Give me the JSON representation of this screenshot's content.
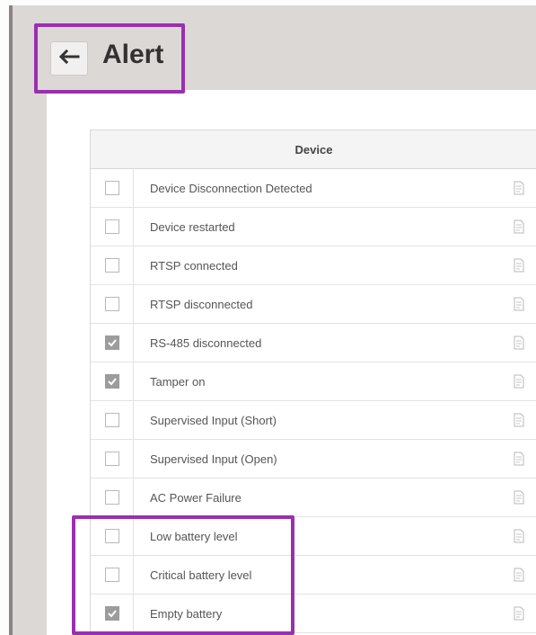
{
  "header": {
    "title": "Alert"
  },
  "icons": {
    "back": "back-arrow-icon",
    "row_action": "document-icon"
  },
  "colors": {
    "highlight": "#9a2fb0",
    "checked": "#9c9c9c"
  },
  "table": {
    "column_header": "Device",
    "rows": [
      {
        "label": "Device Disconnection Detected",
        "checked": false
      },
      {
        "label": "Device restarted",
        "checked": false
      },
      {
        "label": "RTSP connected",
        "checked": false
      },
      {
        "label": "RTSP disconnected",
        "checked": false
      },
      {
        "label": "RS-485 disconnected",
        "checked": true
      },
      {
        "label": "Tamper on",
        "checked": true
      },
      {
        "label": "Supervised Input (Short)",
        "checked": false
      },
      {
        "label": "Supervised Input (Open)",
        "checked": false
      },
      {
        "label": "AC Power Failure",
        "checked": false
      },
      {
        "label": "Low battery level",
        "checked": false
      },
      {
        "label": "Critical battery level",
        "checked": false
      },
      {
        "label": "Empty battery",
        "checked": true
      }
    ]
  }
}
